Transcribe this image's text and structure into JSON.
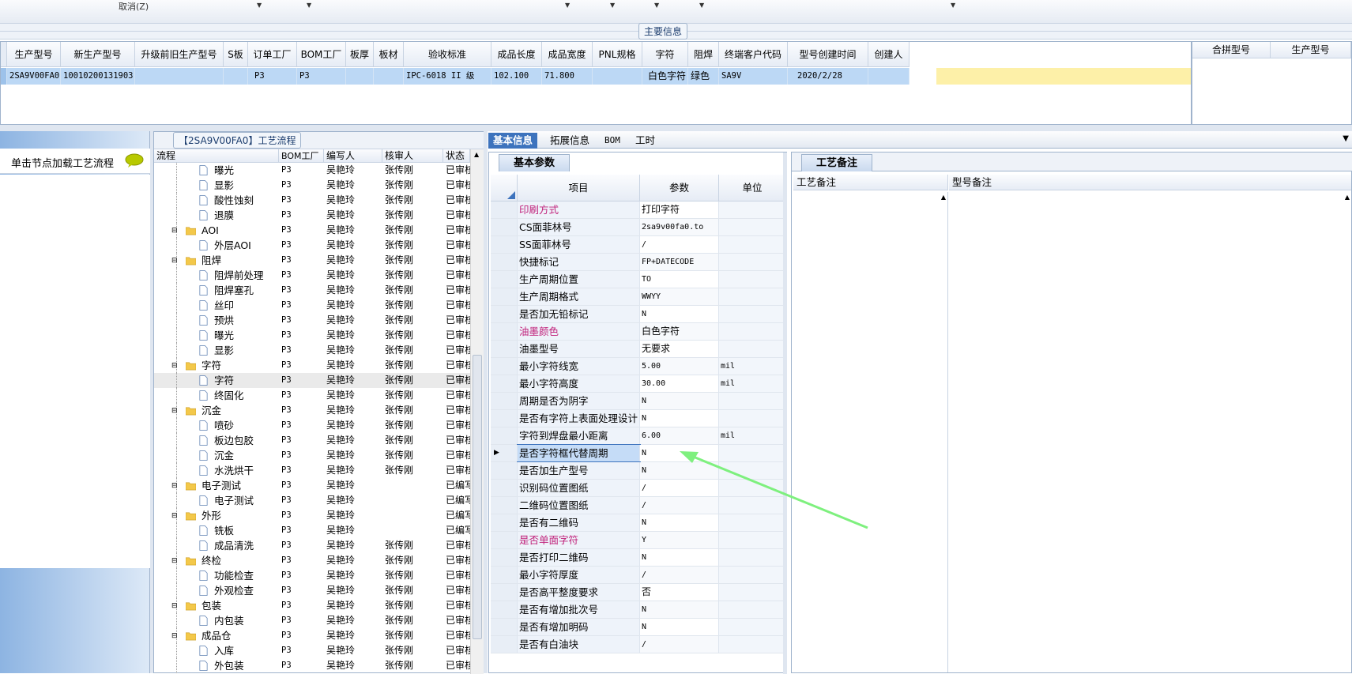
{
  "toolbar": {
    "cancel_label": "取消(Z)"
  },
  "main_info": {
    "title": "主要信息"
  },
  "main_grid": {
    "columns": [
      "生产型号",
      "新生产型号",
      "升级前旧生产型号",
      "S板",
      "订单工厂",
      "BOM工厂",
      "板厚",
      "板材",
      "验收标准",
      "成品长度",
      "成品宽度",
      "PNL规格",
      "字符",
      "阻焊",
      "终端客户代码",
      "型号创建时间",
      "创建人"
    ],
    "row": [
      "2SA9V00FA0",
      "10010200131903",
      "",
      "",
      "P3",
      "P3",
      "",
      "",
      "IPC-6018 II 级",
      "102.100",
      "71.800",
      "",
      "白色字符",
      "绿色",
      "SA9V",
      "2020/2/28",
      ""
    ]
  },
  "merge_grid": {
    "columns": [
      "合拼型号",
      "生产型号"
    ]
  },
  "left_panel": {
    "hint": "单击节点加载工艺流程"
  },
  "flow_panel": {
    "title": "【2SA9V00FA0】工艺流程",
    "columns": [
      "流程",
      "BOM工厂",
      "编写人",
      "核审人",
      "状态"
    ],
    "rows": [
      {
        "name": "曝光",
        "level": 2,
        "bom": "P3",
        "writer": "吴艳玲",
        "reviewer": "张传刚",
        "status": "已审核"
      },
      {
        "name": "显影",
        "level": 2,
        "bom": "P3",
        "writer": "吴艳玲",
        "reviewer": "张传刚",
        "status": "已审核"
      },
      {
        "name": "酸性蚀刻",
        "level": 2,
        "bom": "P3",
        "writer": "吴艳玲",
        "reviewer": "张传刚",
        "status": "已审核"
      },
      {
        "name": "退膜",
        "level": 2,
        "bom": "P3",
        "writer": "吴艳玲",
        "reviewer": "张传刚",
        "status": "已审核"
      },
      {
        "name": "AOI",
        "level": 1,
        "bom": "P3",
        "writer": "吴艳玲",
        "reviewer": "张传刚",
        "status": "已审核"
      },
      {
        "name": "外层AOI",
        "level": 2,
        "bom": "P3",
        "writer": "吴艳玲",
        "reviewer": "张传刚",
        "status": "已审核"
      },
      {
        "name": "阻焊",
        "level": 1,
        "bom": "P3",
        "writer": "吴艳玲",
        "reviewer": "张传刚",
        "status": "已审核"
      },
      {
        "name": "阻焊前处理",
        "level": 2,
        "bom": "P3",
        "writer": "吴艳玲",
        "reviewer": "张传刚",
        "status": "已审核"
      },
      {
        "name": "阻焊塞孔",
        "level": 2,
        "bom": "P3",
        "writer": "吴艳玲",
        "reviewer": "张传刚",
        "status": "已审核"
      },
      {
        "name": "丝印",
        "level": 2,
        "bom": "P3",
        "writer": "吴艳玲",
        "reviewer": "张传刚",
        "status": "已审核"
      },
      {
        "name": "预烘",
        "level": 2,
        "bom": "P3",
        "writer": "吴艳玲",
        "reviewer": "张传刚",
        "status": "已审核"
      },
      {
        "name": "曝光",
        "level": 2,
        "bom": "P3",
        "writer": "吴艳玲",
        "reviewer": "张传刚",
        "status": "已审核"
      },
      {
        "name": "显影",
        "level": 2,
        "bom": "P3",
        "writer": "吴艳玲",
        "reviewer": "张传刚",
        "status": "已审核"
      },
      {
        "name": "字符",
        "level": 1,
        "bom": "P3",
        "writer": "吴艳玲",
        "reviewer": "张传刚",
        "status": "已审核"
      },
      {
        "name": "字符",
        "level": 2,
        "bom": "P3",
        "writer": "吴艳玲",
        "reviewer": "张传刚",
        "status": "已审核",
        "selected": true
      },
      {
        "name": "终固化",
        "level": 2,
        "bom": "P3",
        "writer": "吴艳玲",
        "reviewer": "张传刚",
        "status": "已审核"
      },
      {
        "name": "沉金",
        "level": 1,
        "bom": "P3",
        "writer": "吴艳玲",
        "reviewer": "张传刚",
        "status": "已审核"
      },
      {
        "name": "喷砂",
        "level": 2,
        "bom": "P3",
        "writer": "吴艳玲",
        "reviewer": "张传刚",
        "status": "已审核"
      },
      {
        "name": "板边包胶",
        "level": 2,
        "bom": "P3",
        "writer": "吴艳玲",
        "reviewer": "张传刚",
        "status": "已审核"
      },
      {
        "name": "沉金",
        "level": 2,
        "bom": "P3",
        "writer": "吴艳玲",
        "reviewer": "张传刚",
        "status": "已审核"
      },
      {
        "name": "水洗烘干",
        "level": 2,
        "bom": "P3",
        "writer": "吴艳玲",
        "reviewer": "张传刚",
        "status": "已审核"
      },
      {
        "name": "电子测试",
        "level": 1,
        "bom": "P3",
        "writer": "吴艳玲",
        "reviewer": "",
        "status": "已编写"
      },
      {
        "name": "电子测试",
        "level": 2,
        "bom": "P3",
        "writer": "吴艳玲",
        "reviewer": "",
        "status": "已编写"
      },
      {
        "name": "外形",
        "level": 1,
        "bom": "P3",
        "writer": "吴艳玲",
        "reviewer": "",
        "status": "已编写"
      },
      {
        "name": "铣板",
        "level": 2,
        "bom": "P3",
        "writer": "吴艳玲",
        "reviewer": "",
        "status": "已编写"
      },
      {
        "name": "成品清洗",
        "level": 2,
        "bom": "P3",
        "writer": "吴艳玲",
        "reviewer": "张传刚",
        "status": "已审核"
      },
      {
        "name": "终检",
        "level": 1,
        "bom": "P3",
        "writer": "吴艳玲",
        "reviewer": "张传刚",
        "status": "已审核"
      },
      {
        "name": "功能检查",
        "level": 2,
        "bom": "P3",
        "writer": "吴艳玲",
        "reviewer": "张传刚",
        "status": "已审核"
      },
      {
        "name": "外观检查",
        "level": 2,
        "bom": "P3",
        "writer": "吴艳玲",
        "reviewer": "张传刚",
        "status": "已审核"
      },
      {
        "name": "包装",
        "level": 1,
        "bom": "P3",
        "writer": "吴艳玲",
        "reviewer": "张传刚",
        "status": "已审核"
      },
      {
        "name": "内包装",
        "level": 2,
        "bom": "P3",
        "writer": "吴艳玲",
        "reviewer": "张传刚",
        "status": "已审核"
      },
      {
        "name": "成品仓",
        "level": 1,
        "bom": "P3",
        "writer": "吴艳玲",
        "reviewer": "张传刚",
        "status": "已审核"
      },
      {
        "name": "入库",
        "level": 2,
        "bom": "P3",
        "writer": "吴艳玲",
        "reviewer": "张传刚",
        "status": "已审核"
      },
      {
        "name": "外包装",
        "level": 2,
        "bom": "P3",
        "writer": "吴艳玲",
        "reviewer": "张传刚",
        "status": "已审核"
      }
    ]
  },
  "right_tabs": [
    "基本信息",
    "拓展信息",
    "BOM",
    "工时"
  ],
  "basic_panel": {
    "tab": "基本参数",
    "columns": [
      "项目",
      "参数",
      "单位"
    ],
    "rows": [
      {
        "name": "印刷方式",
        "value": "打印字符",
        "unit": "",
        "highlight": true,
        "mono": false
      },
      {
        "name": "CS面菲林号",
        "value": "2sa9v00fa0.to",
        "unit": "",
        "mono": true
      },
      {
        "name": "SS面菲林号",
        "value": "/",
        "unit": "",
        "mono": true
      },
      {
        "name": "快捷标记",
        "value": "FP+DATECODE",
        "unit": "",
        "mono": true
      },
      {
        "name": "生产周期位置",
        "value": "TO",
        "unit": "",
        "mono": true
      },
      {
        "name": "生产周期格式",
        "value": "WWYY",
        "unit": "",
        "mono": true
      },
      {
        "name": "是否加无铅标记",
        "value": "N",
        "unit": "",
        "mono": true
      },
      {
        "name": "油墨颜色",
        "value": "白色字符",
        "unit": "",
        "highlight": true,
        "mono": false
      },
      {
        "name": "油墨型号",
        "value": "无要求",
        "unit": "",
        "mono": false
      },
      {
        "name": "最小字符线宽",
        "value": "5.00",
        "unit": "mil",
        "mono": true
      },
      {
        "name": "最小字符高度",
        "value": "30.00",
        "unit": "mil",
        "mono": true
      },
      {
        "name": "周期是否为阴字",
        "value": "N",
        "unit": "",
        "mono": true
      },
      {
        "name": "是否有字符上表面处理设计",
        "value": "N",
        "unit": "",
        "mono": true
      },
      {
        "name": "字符到焊盘最小距离",
        "value": "6.00",
        "unit": "mil",
        "mono": true
      },
      {
        "name": "是否字符框代替周期",
        "value": "N",
        "unit": "",
        "mono": true,
        "current": true
      },
      {
        "name": "是否加生产型号",
        "value": "N",
        "unit": "",
        "mono": true
      },
      {
        "name": "识别码位置图纸",
        "value": "/",
        "unit": "",
        "mono": true
      },
      {
        "name": "二维码位置图纸",
        "value": "/",
        "unit": "",
        "mono": true
      },
      {
        "name": "是否有二维码",
        "value": "N",
        "unit": "",
        "mono": true
      },
      {
        "name": "是否单面字符",
        "value": "Y",
        "unit": "",
        "highlight": true,
        "mono": true
      },
      {
        "name": "是否打印二维码",
        "value": "N",
        "unit": "",
        "mono": true
      },
      {
        "name": "最小字符厚度",
        "value": "/",
        "unit": "",
        "mono": true
      },
      {
        "name": "是否高平整度要求",
        "value": "否",
        "unit": "",
        "mono": false
      },
      {
        "name": "是否有增加批次号",
        "value": "N",
        "unit": "",
        "mono": true
      },
      {
        "name": "是否有增加明码",
        "value": "N",
        "unit": "",
        "mono": true
      },
      {
        "name": "是否有白油块",
        "value": "/",
        "unit": "",
        "mono": true
      }
    ]
  },
  "craft_panel": {
    "tab": "工艺备注",
    "col1": "工艺备注",
    "col2": "型号备注"
  },
  "colors": {
    "accent": "#3d73bd",
    "highlight_text": "#c0207a",
    "selection": "#bcd8f5",
    "arrow": "#7ef07e",
    "folder": "#f3c84a"
  }
}
